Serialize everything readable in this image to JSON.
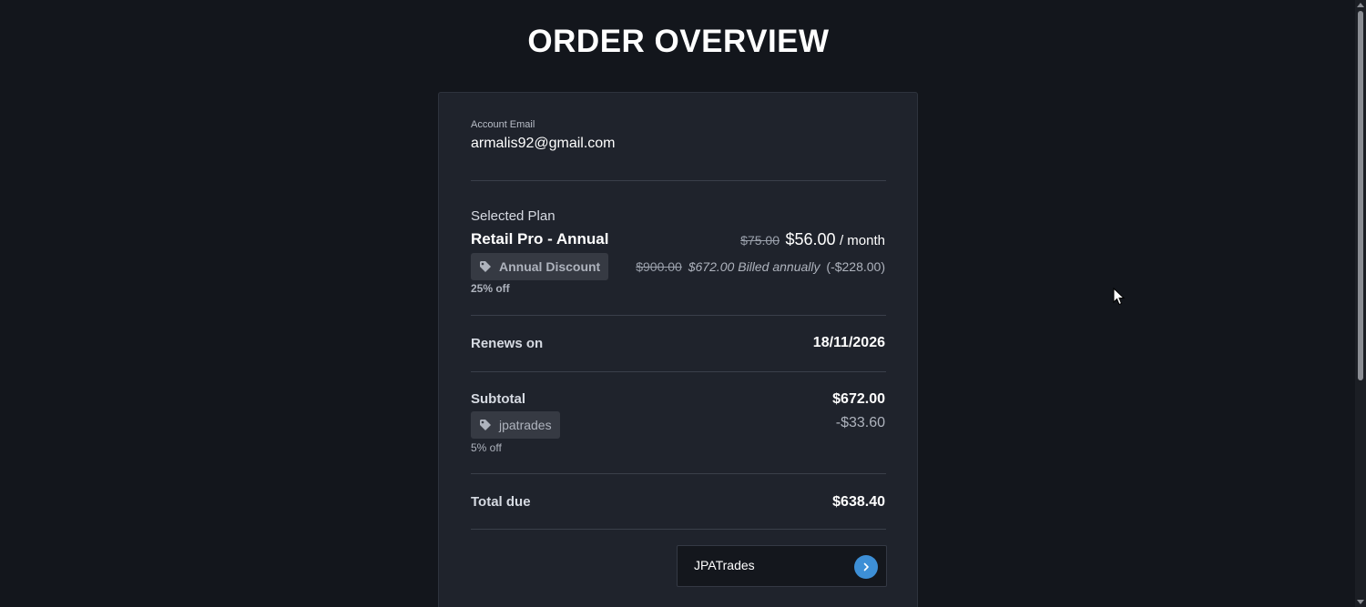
{
  "page": {
    "title": "ORDER OVERVIEW"
  },
  "account": {
    "label": "Account Email",
    "email": "armalis92@gmail.com"
  },
  "plan": {
    "section_label": "Selected Plan",
    "name": "Retail Pro - Annual",
    "old_price": "$75.00",
    "price": "$56.00",
    "period": "/ month",
    "discount_name": "Annual Discount",
    "discount_percent": "25% off",
    "old_annual": "$900.00",
    "annual_billing": "$672.00 Billed annually",
    "annual_saving": "(-$228.00)"
  },
  "renewal": {
    "label": "Renews on",
    "date": "18/11/2026"
  },
  "subtotal": {
    "label": "Subtotal",
    "value": "$672.00",
    "coupon_code": "jpatrades",
    "coupon_percent": "5% off",
    "coupon_discount": "-$33.60"
  },
  "total": {
    "label": "Total due",
    "value": "$638.40"
  },
  "payment_button": {
    "label": "JPATrades",
    "icon": "chevron-right-icon"
  },
  "colors": {
    "background": "#13161c",
    "card": "#1f232c",
    "chip": "#363a43",
    "accent": "#3d8fd6"
  }
}
